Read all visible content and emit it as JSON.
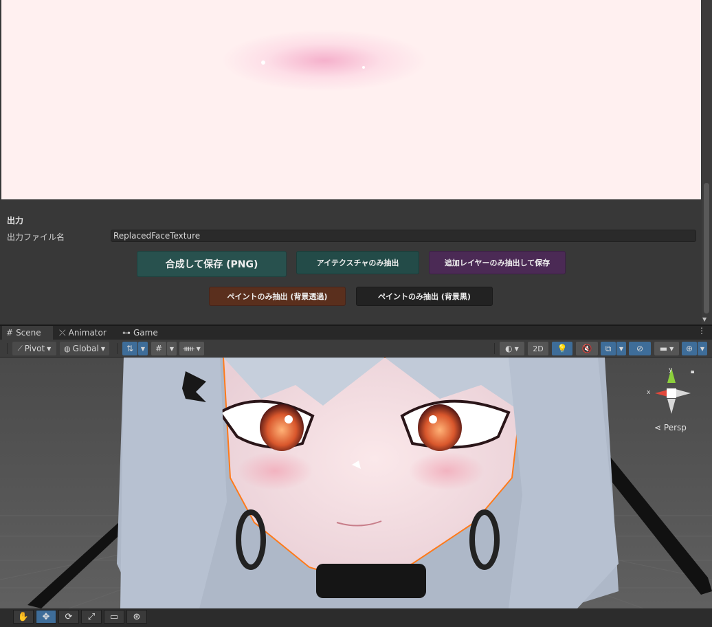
{
  "output": {
    "section_title": "出力",
    "filename_label": "出力ファイル名",
    "filename_value": "ReplacedFaceTexture"
  },
  "buttons": {
    "compose_save": "合成して保存 (PNG)",
    "extract_eye_texture": "アイテクスチャのみ抽出",
    "extract_layers_save": "追加レイヤーのみ抽出して保存",
    "extract_paint_transparent": "ペイントのみ抽出 (背景透過)",
    "extract_paint_black": "ペイントのみ抽出 (背景黒)"
  },
  "tabs": [
    {
      "label": "Scene",
      "icon": "grid-icon"
    },
    {
      "label": "Animator",
      "icon": "animator-icon"
    },
    {
      "label": "Game",
      "icon": "gamepad-icon"
    }
  ],
  "scene_toolbar": {
    "pivot": "Pivot",
    "global": "Global",
    "mode_2d": "2D"
  },
  "gizmo": {
    "projection": "Persp",
    "x_axis": "x",
    "y_axis": "y"
  },
  "colors": {
    "compose_button": "#28514e",
    "eye_button": "#234b48",
    "layer_button": "#4b2a55",
    "paint_transparent_button": "#5a2f1d",
    "paint_black_button": "#222222",
    "active_tool": "#3e6d99"
  },
  "tools": [
    "hand-icon",
    "move-icon",
    "rotate-icon",
    "scale-icon",
    "rect-icon",
    "transform-icon"
  ]
}
